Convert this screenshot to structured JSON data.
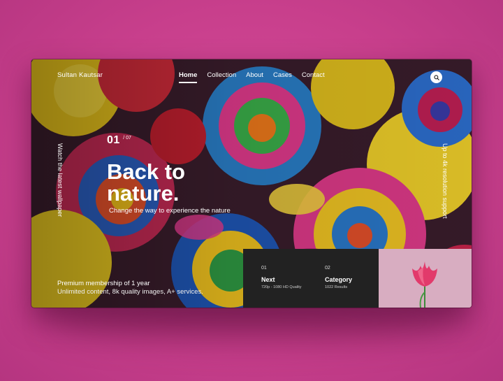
{
  "header": {
    "brand": "Sultan Kautsar",
    "nav": [
      {
        "label": "Home",
        "active": true
      },
      {
        "label": "Collection",
        "active": false
      },
      {
        "label": "About",
        "active": false
      },
      {
        "label": "Cases",
        "active": false
      },
      {
        "label": "Contact",
        "active": false
      }
    ],
    "search_icon": "search-icon"
  },
  "side": {
    "left": "Watch the latest wallpaper",
    "right": "Up to 4k resolution support"
  },
  "hero": {
    "counter_current": "01",
    "counter_total": "/ 07",
    "headline_line1": "Back to",
    "headline_line2": "nature.",
    "subline": "Change the way to experience the nature"
  },
  "promo": {
    "line1": "Premium membership of 1 year",
    "line2": "Unlimited content, 8k quality images, A+ services."
  },
  "panel": {
    "items": [
      {
        "num": "01",
        "title": "Next",
        "meta": "720p - 1080 HD Quality"
      },
      {
        "num": "02",
        "title": "Category",
        "meta": "1022 Results"
      }
    ]
  },
  "colors": {
    "page_background": "#c8438f",
    "panel_background": "#222222",
    "thumbnail_background": "#d9aec2"
  }
}
